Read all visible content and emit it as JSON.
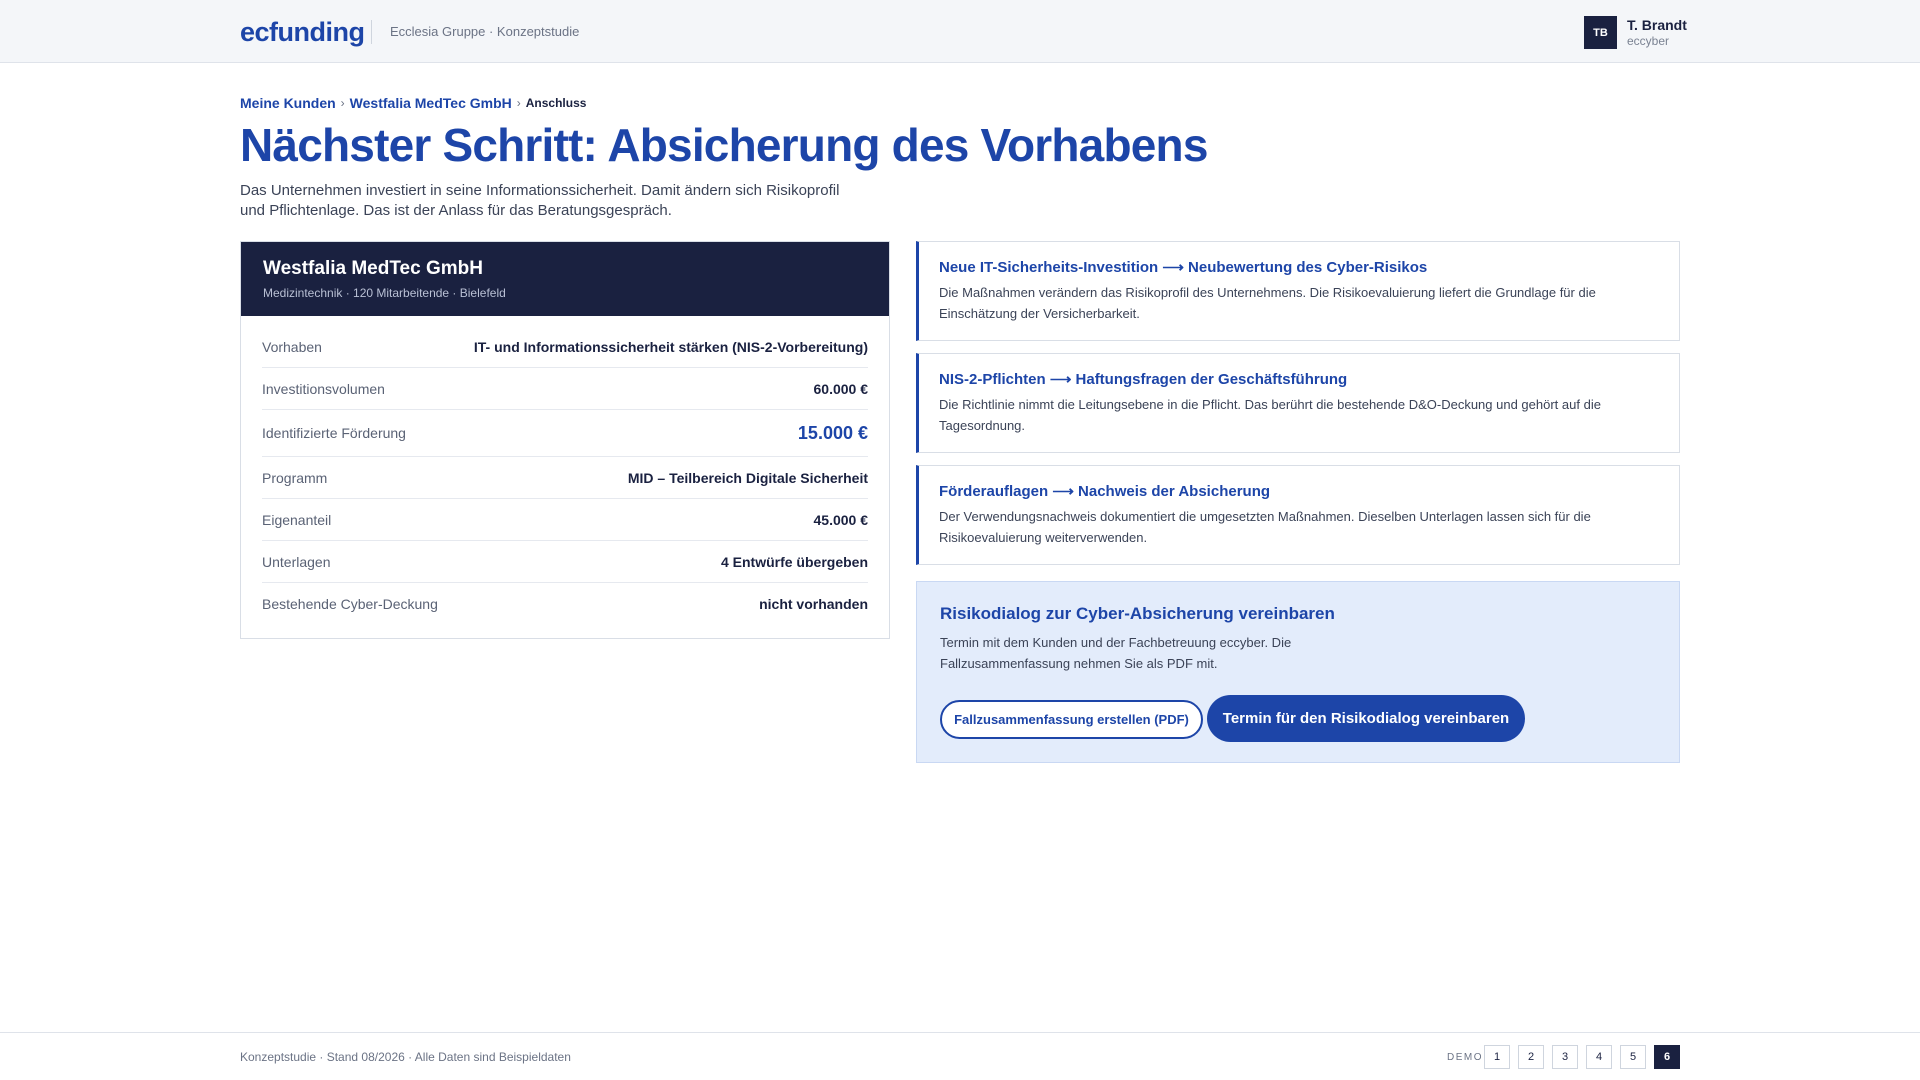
{
  "header": {
    "logo": "ecfunding",
    "org": "Ecclesia Gruppe · Konzeptstudie",
    "user": {
      "initials": "TB",
      "name": "T. Brandt",
      "org": "eccyber"
    }
  },
  "breadcrumb": {
    "items": [
      "Meine Kunden",
      "Westfalia MedTec GmbH"
    ],
    "separator": "›",
    "current": "Anschluss"
  },
  "page": {
    "title": "Nächster Schritt: Absicherung des Vorhabens",
    "description": "Das Unternehmen investiert in seine Informationssicherheit. Damit ändern sich Risikoprofil und Pflichtenlage. Das ist der Anlass für das Beratungsgespräch."
  },
  "client_card": {
    "title": "Westfalia MedTec GmbH",
    "subtitle": "Medizintechnik · 120 Mitarbeitende · Bielefeld",
    "rows": [
      {
        "label": "Vorhaben",
        "value": "IT- und Informationssicherheit stärken (NIS-2-Vorbereitung)"
      },
      {
        "label": "Investitionsvolumen",
        "value": "60.000 €"
      },
      {
        "label": "Identifizierte Förderung",
        "value": "15.000 €"
      },
      {
        "label": "Programm",
        "value": "MID – Teilbereich Digitale Sicherheit"
      },
      {
        "label": "Eigenanteil",
        "value": "45.000 €"
      },
      {
        "label": "Unterlagen",
        "value": "4 Entwürfe übergeben"
      },
      {
        "label": "Bestehende Cyber-Deckung",
        "value": "nicht vorhanden"
      }
    ]
  },
  "insights": [
    {
      "title": "Neue IT-Sicherheits-Investition ⟶ Neubewertung des Cyber-Risikos",
      "text": "Die Maßnahmen verändern das Risikoprofil des Unternehmens. Die Risikoevaluierung liefert die Grundlage für die Einschätzung der Versicherbarkeit."
    },
    {
      "title": "NIS-2-Pflichten ⟶ Haftungsfragen der Geschäftsführung",
      "text": "Die Richtlinie nimmt die Leitungsebene in die Pflicht. Das berührt die bestehende D&O-Deckung und gehört auf die Tagesordnung."
    },
    {
      "title": "Förderauflagen ⟶ Nachweis der Absicherung",
      "text": "Der Verwendungsnachweis dokumentiert die umgesetzten Maßnahmen. Dieselben Unterlagen lassen sich für die Risikoevaluierung weiterverwenden."
    }
  ],
  "cta": {
    "title": "Risikodialog zur Cyber-Absicherung vereinbaren",
    "text": "Termin mit dem Kunden und der Fachbetreuung eccyber. Die Fallzusammenfassung nehmen Sie als PDF mit.",
    "secondary_button": "Fallzusammenfassung erstellen (PDF)",
    "primary_button": "Termin für den Risikodialog vereinbaren"
  },
  "footer": {
    "note": "Konzeptstudie · Stand 08/2026 · Alle Daten sind Beispieldaten",
    "demo_label": "DEMO",
    "pages": [
      "1",
      "2",
      "3",
      "4",
      "5",
      "6"
    ],
    "active_page": "6"
  },
  "colors": {
    "brand": "#1d45a8",
    "dark": "#1a2140",
    "cta_bg": "#e3ecfb"
  }
}
